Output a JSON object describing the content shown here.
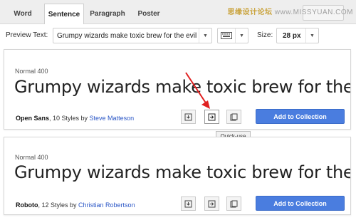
{
  "tabs": [
    {
      "label": "Word",
      "active": false
    },
    {
      "label": "Sentence",
      "active": true
    },
    {
      "label": "Paragraph",
      "active": false
    },
    {
      "label": "Poster",
      "active": false
    }
  ],
  "watermark": {
    "brand": "思缘设计论坛",
    "url": "www.MISSYUAN.COM"
  },
  "settings": {
    "preview_label": "Preview Text:",
    "preview_value": "Grumpy wizards make toxic brew for the evil Queen and Jack",
    "size_label": "Size:",
    "size_value": "28 px"
  },
  "cards": [
    {
      "style": "Normal 400",
      "sample": "Grumpy wizards make toxic brew for the evil Queen and Jack",
      "font_name": "Open Sans",
      "styles_text": ", 10 Styles by ",
      "author": "Steve Matteson",
      "add_label": "Add to Collection"
    },
    {
      "style": "Normal 400",
      "sample": "Grumpy wizards make toxic brew for the evil Queen and Jack",
      "font_name": "Roboto",
      "styles_text": ", 12 Styles by ",
      "author": "Christian Robertson",
      "add_label": "Add to Collection"
    }
  ],
  "tooltip": "Quick-use",
  "icons": [
    "download-icon",
    "quick-use-icon",
    "pop-out-icon",
    "keyboard-icon",
    "grid-icon"
  ],
  "colors": {
    "accent": "#4a7ddf",
    "author_link": "#2a56c6",
    "arrow": "#e02020"
  }
}
